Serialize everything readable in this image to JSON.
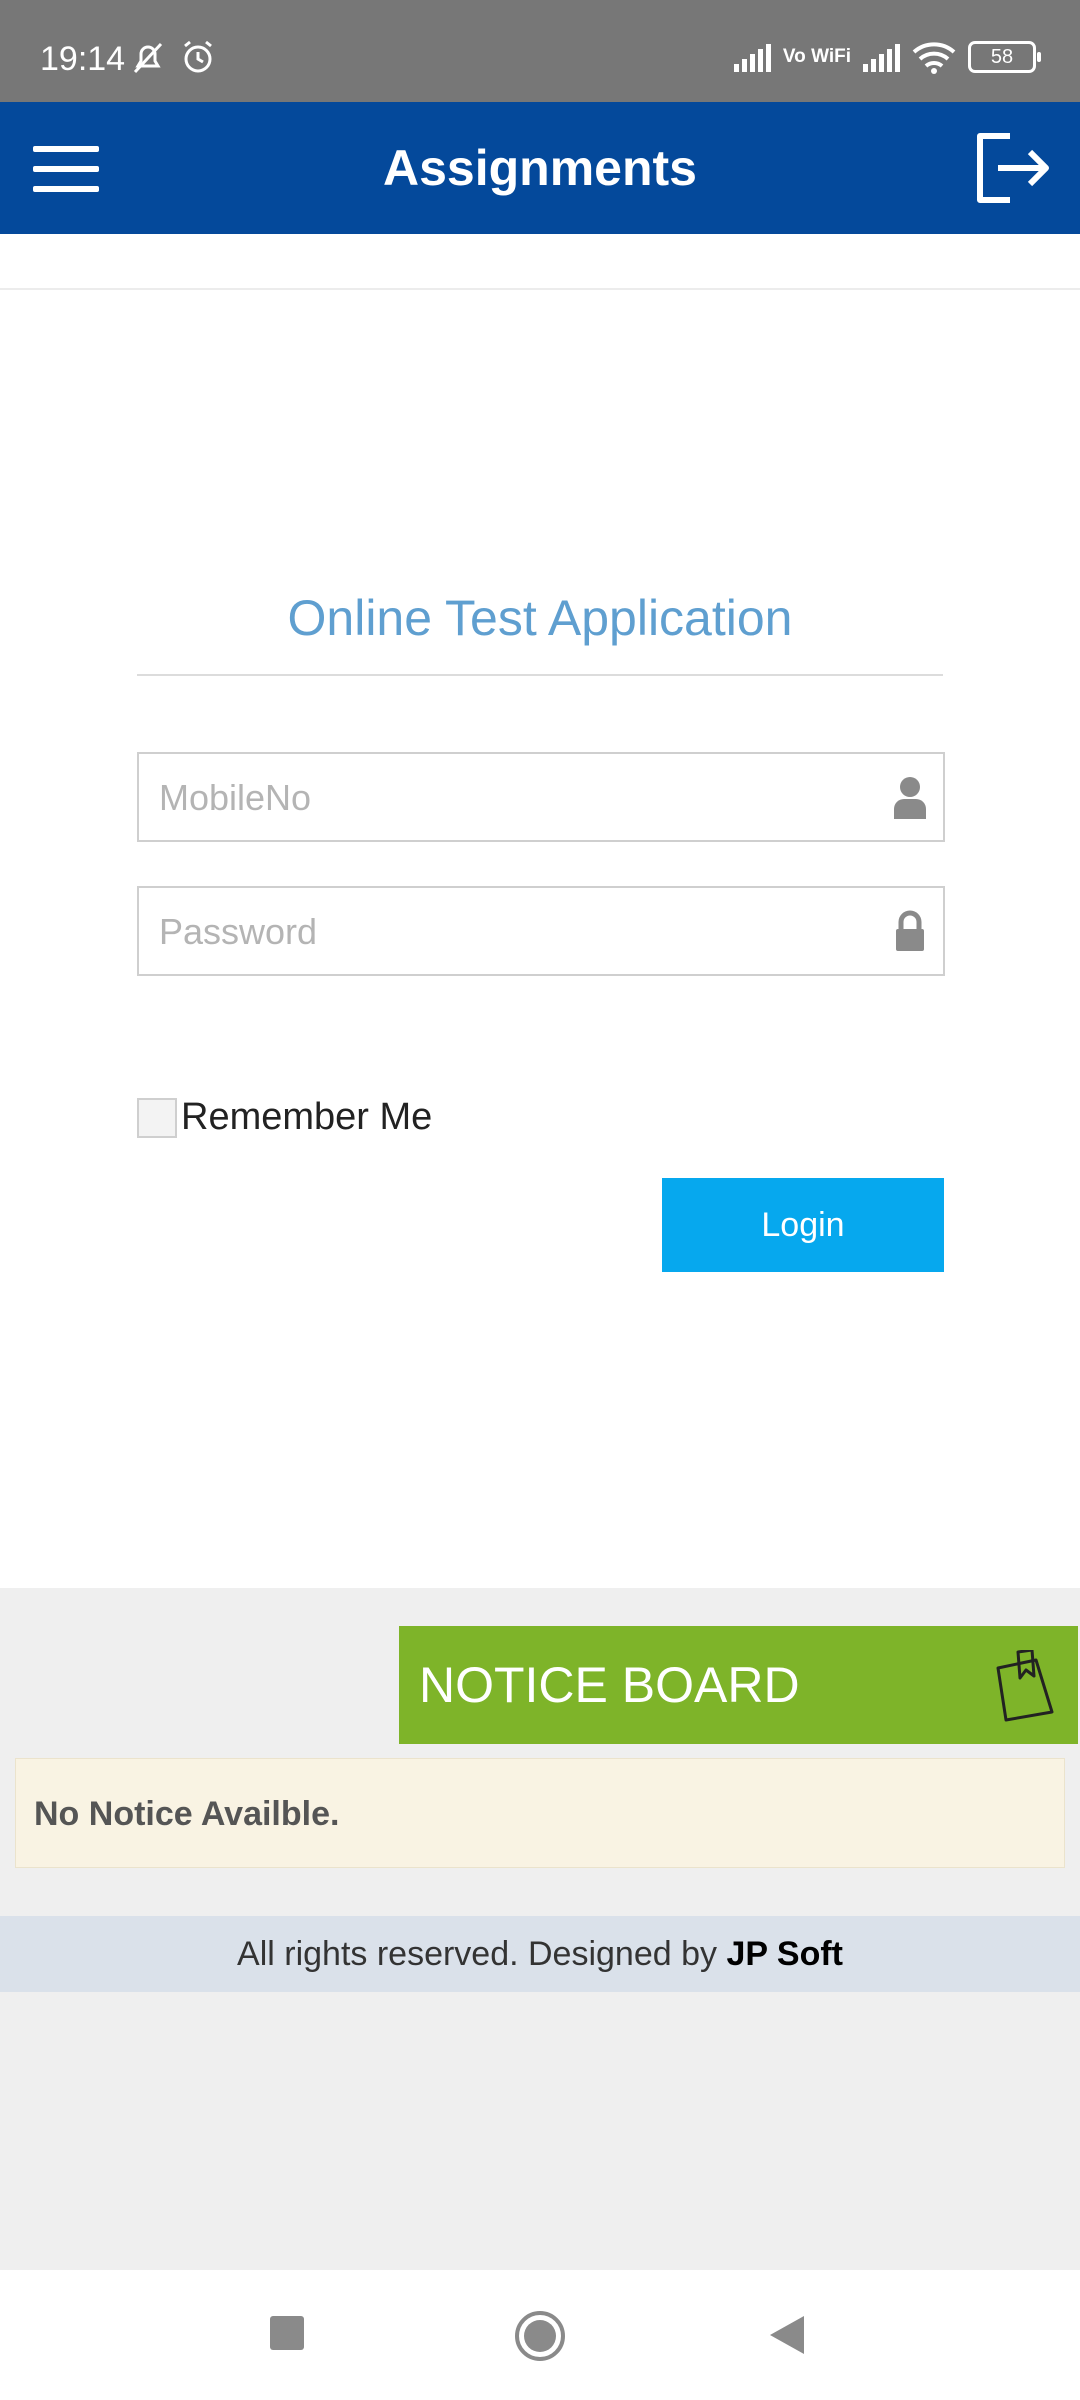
{
  "status_bar": {
    "time": "19:14",
    "network_label": "Vo WiFi",
    "battery": "58",
    "icons": [
      "mute-bell-icon",
      "alarm-icon",
      "signal-icon",
      "wifi-icon",
      "battery-icon"
    ]
  },
  "app_bar": {
    "title": "Assignments",
    "menu_icon": "hamburger-menu-icon",
    "logout_icon": "logout-icon"
  },
  "login": {
    "heading": "Online Test Application",
    "mobile_placeholder": "MobileNo",
    "password_placeholder": "Password",
    "remember_label": "Remember Me",
    "login_label": "Login"
  },
  "notice_board": {
    "title": "NOTICE BOARD",
    "message": "No Notice Availble."
  },
  "footer": {
    "text": "All rights reserved. Designed by ",
    "brand": "JP Soft"
  },
  "colors": {
    "app_bar": "#04499b",
    "login_button": "#06a8ee",
    "notice_header": "#7eb429",
    "heading": "#5f9fd0"
  }
}
